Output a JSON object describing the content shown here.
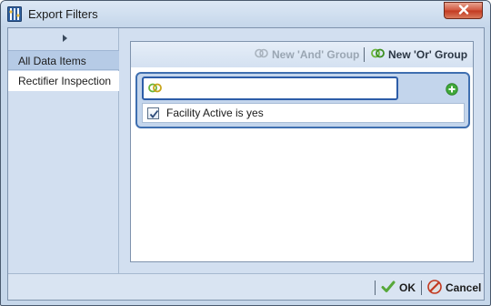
{
  "window": {
    "title": "Export Filters",
    "icon": "app-document-icon",
    "close_icon": "close-icon"
  },
  "nav": {
    "collapse_icon": "chevron-right-icon",
    "items": [
      {
        "label": "All Data Items",
        "selected": true
      },
      {
        "label": "Rectifier Inspection",
        "selected": false
      }
    ]
  },
  "filter": {
    "new_and_group": {
      "label": "New 'And' Group",
      "enabled": false,
      "icon": "and-group-icon"
    },
    "new_or_group": {
      "label": "New 'Or' Group",
      "enabled": true,
      "icon": "or-group-icon"
    },
    "group": {
      "logic_icon": "or-group-icon",
      "add_icon": "add-condition-icon",
      "input_value": "",
      "conditions": [
        {
          "text": "Facility Active is yes",
          "checked": true
        }
      ]
    }
  },
  "footer": {
    "ok_label": "OK",
    "cancel_label": "Cancel"
  },
  "colors": {
    "accent_border": "#3f6fb0",
    "group_bg": "#c3d5ec",
    "or_icon_green": "#6ab53a",
    "add_green": "#3fa83a",
    "close_red": "#c2381f"
  }
}
